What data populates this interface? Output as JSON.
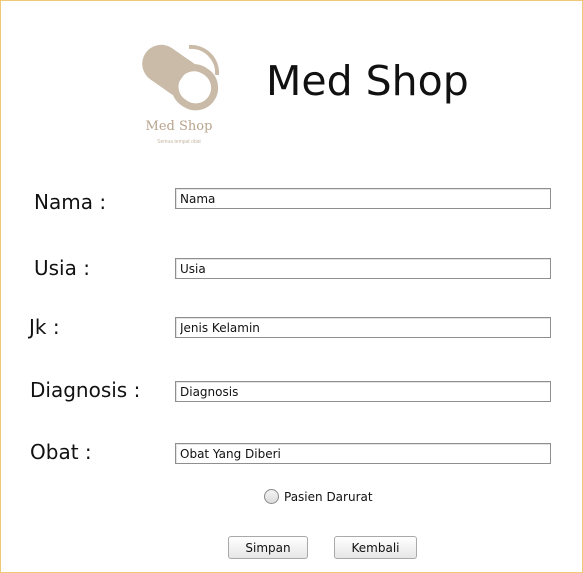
{
  "app": {
    "title": "Med Shop",
    "logo_name": "Med Shop",
    "logo_tagline": "Semua tempat obat"
  },
  "form": {
    "nama_label": "Nama :",
    "nama_value": "Nama",
    "usia_label": "Usia :",
    "usia_value": "Usia",
    "jk_label": "Jk :",
    "jk_value": "Jenis Kelamin",
    "diagnosis_label": "Diagnosis :",
    "diagnosis_value": "Diagnosis",
    "obat_label": "Obat :",
    "obat_value": "Obat Yang Diberi",
    "darurat_label": "Pasien Darurat",
    "darurat_checked": false
  },
  "actions": {
    "simpan_label": "Simpan",
    "kembali_label": "Kembali"
  },
  "colors": {
    "logo": "#c9bba8",
    "window_border": "#f0c878"
  },
  "icons": {
    "logo": "pill-capsule-icon"
  }
}
